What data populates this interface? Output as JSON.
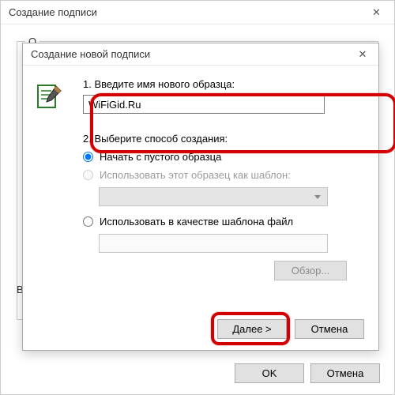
{
  "outer": {
    "title": "Создание подписи",
    "group_label_prefix": "О",
    "left_label_prefix": "Вн",
    "ok": "OK",
    "cancel": "Отмена"
  },
  "inner": {
    "title": "Создание новой подписи",
    "step1_label": "1. Введите имя нового образца:",
    "name_value": "WiFiGid.Ru",
    "step2_label": "2. Выберите способ создания:",
    "radio_blank": "Начать с пустого образца",
    "radio_template": "Использовать этот образец как шаблон:",
    "radio_file": "Использовать в качестве шаблона файл",
    "browse": "Обзор...",
    "next": "Далее >",
    "cancel": "Отмена"
  },
  "icons": {
    "close": "✕"
  }
}
